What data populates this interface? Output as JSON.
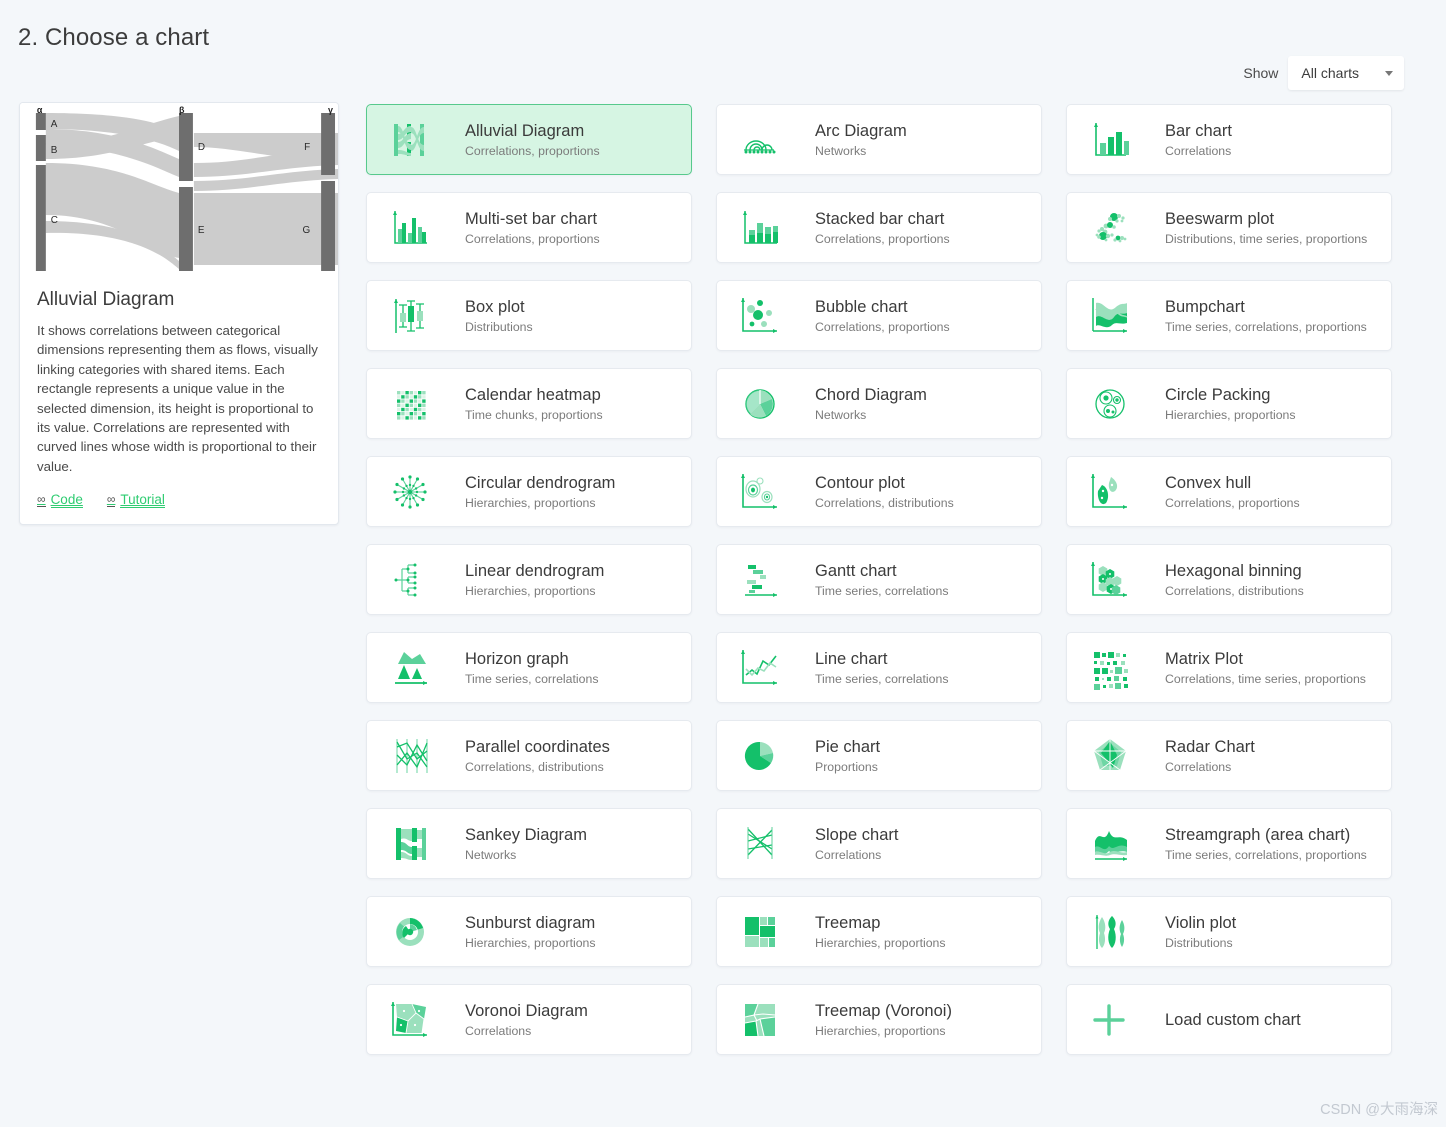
{
  "page": {
    "title": "2. Choose a chart",
    "watermark": "CSDN @大雨海深",
    "accent_color": "#14c06a",
    "accent_light": "#9be0bd",
    "selected_bg": "#d6f5e3",
    "selected_border": "#57c98c",
    "background": "#f4f7fa"
  },
  "filter": {
    "label": "Show",
    "selected": "All charts",
    "caret_icon": "chevron-down-icon"
  },
  "preview": {
    "title": "Alluvial Diagram",
    "description": "It shows correlations between categorical dimensions representing them as flows, visually linking categories with shared items. Each rectangle represents a unique value in the selected dimension, its height is proportional to its value. Correlations are represented with curved lines whose width is proportional to their value.",
    "links": [
      {
        "label": "Code",
        "icon": "link-icon"
      },
      {
        "label": "Tutorial",
        "icon": "link-icon"
      }
    ],
    "figure": {
      "type": "alluvial",
      "axis_labels": [
        "α",
        "β",
        "γ"
      ],
      "nodes": [
        "A",
        "B",
        "C",
        "D",
        "E",
        "F",
        "G"
      ]
    }
  },
  "charts": [
    {
      "name": "Alluvial Diagram",
      "tags": "Correlations, proportions",
      "icon": "alluvial-icon",
      "selected": true
    },
    {
      "name": "Arc Diagram",
      "tags": "Networks",
      "icon": "arc-diagram-icon",
      "selected": false
    },
    {
      "name": "Bar chart",
      "tags": "Correlations",
      "icon": "bar-chart-icon",
      "selected": false
    },
    {
      "name": "Multi-set bar chart",
      "tags": "Correlations, proportions",
      "icon": "multiset-bar-icon",
      "selected": false
    },
    {
      "name": "Stacked bar chart",
      "tags": "Correlations, proportions",
      "icon": "stacked-bar-icon",
      "selected": false
    },
    {
      "name": "Beeswarm plot",
      "tags": "Distributions, time series, proportions",
      "icon": "beeswarm-icon",
      "selected": false
    },
    {
      "name": "Box plot",
      "tags": "Distributions",
      "icon": "box-plot-icon",
      "selected": false
    },
    {
      "name": "Bubble chart",
      "tags": "Correlations, proportions",
      "icon": "bubble-chart-icon",
      "selected": false
    },
    {
      "name": "Bumpchart",
      "tags": "Time series, correlations, proportions",
      "icon": "bumpchart-icon",
      "selected": false
    },
    {
      "name": "Calendar heatmap",
      "tags": "Time chunks, proportions",
      "icon": "calendar-heatmap-icon",
      "selected": false
    },
    {
      "name": "Chord Diagram",
      "tags": "Networks",
      "icon": "chord-diagram-icon",
      "selected": false
    },
    {
      "name": "Circle Packing",
      "tags": "Hierarchies, proportions",
      "icon": "circle-packing-icon",
      "selected": false
    },
    {
      "name": "Circular dendrogram",
      "tags": "Hierarchies, proportions",
      "icon": "circular-dendrogram-icon",
      "selected": false
    },
    {
      "name": "Contour plot",
      "tags": "Correlations, distributions",
      "icon": "contour-plot-icon",
      "selected": false
    },
    {
      "name": "Convex hull",
      "tags": "Correlations, proportions",
      "icon": "convex-hull-icon",
      "selected": false
    },
    {
      "name": "Linear dendrogram",
      "tags": "Hierarchies, proportions",
      "icon": "linear-dendrogram-icon",
      "selected": false
    },
    {
      "name": "Gantt chart",
      "tags": "Time series, correlations",
      "icon": "gantt-chart-icon",
      "selected": false
    },
    {
      "name": "Hexagonal binning",
      "tags": "Correlations, distributions",
      "icon": "hexagonal-binning-icon",
      "selected": false
    },
    {
      "name": "Horizon graph",
      "tags": "Time series, correlations",
      "icon": "horizon-graph-icon",
      "selected": false
    },
    {
      "name": "Line chart",
      "tags": "Time series, correlations",
      "icon": "line-chart-icon",
      "selected": false
    },
    {
      "name": "Matrix Plot",
      "tags": "Correlations, time series, proportions",
      "icon": "matrix-plot-icon",
      "selected": false
    },
    {
      "name": "Parallel coordinates",
      "tags": "Correlations, distributions",
      "icon": "parallel-coordinates-icon",
      "selected": false
    },
    {
      "name": "Pie chart",
      "tags": "Proportions",
      "icon": "pie-chart-icon",
      "selected": false
    },
    {
      "name": "Radar Chart",
      "tags": "Correlations",
      "icon": "radar-chart-icon",
      "selected": false
    },
    {
      "name": "Sankey Diagram",
      "tags": "Networks",
      "icon": "sankey-diagram-icon",
      "selected": false
    },
    {
      "name": "Slope chart",
      "tags": "Correlations",
      "icon": "slope-chart-icon",
      "selected": false
    },
    {
      "name": "Streamgraph (area chart)",
      "tags": "Time series, correlations, proportions",
      "icon": "streamgraph-icon",
      "selected": false
    },
    {
      "name": "Sunburst diagram",
      "tags": "Hierarchies, proportions",
      "icon": "sunburst-diagram-icon",
      "selected": false
    },
    {
      "name": "Treemap",
      "tags": "Hierarchies, proportions",
      "icon": "treemap-icon",
      "selected": false
    },
    {
      "name": "Violin plot",
      "tags": "Distributions",
      "icon": "violin-plot-icon",
      "selected": false
    },
    {
      "name": "Voronoi Diagram",
      "tags": "Correlations",
      "icon": "voronoi-diagram-icon",
      "selected": false
    },
    {
      "name": "Treemap (Voronoi)",
      "tags": "Hierarchies, proportions",
      "icon": "treemap-voronoi-icon",
      "selected": false
    },
    {
      "name": "Load custom chart",
      "tags": "",
      "icon": "plus-icon",
      "selected": false
    }
  ]
}
